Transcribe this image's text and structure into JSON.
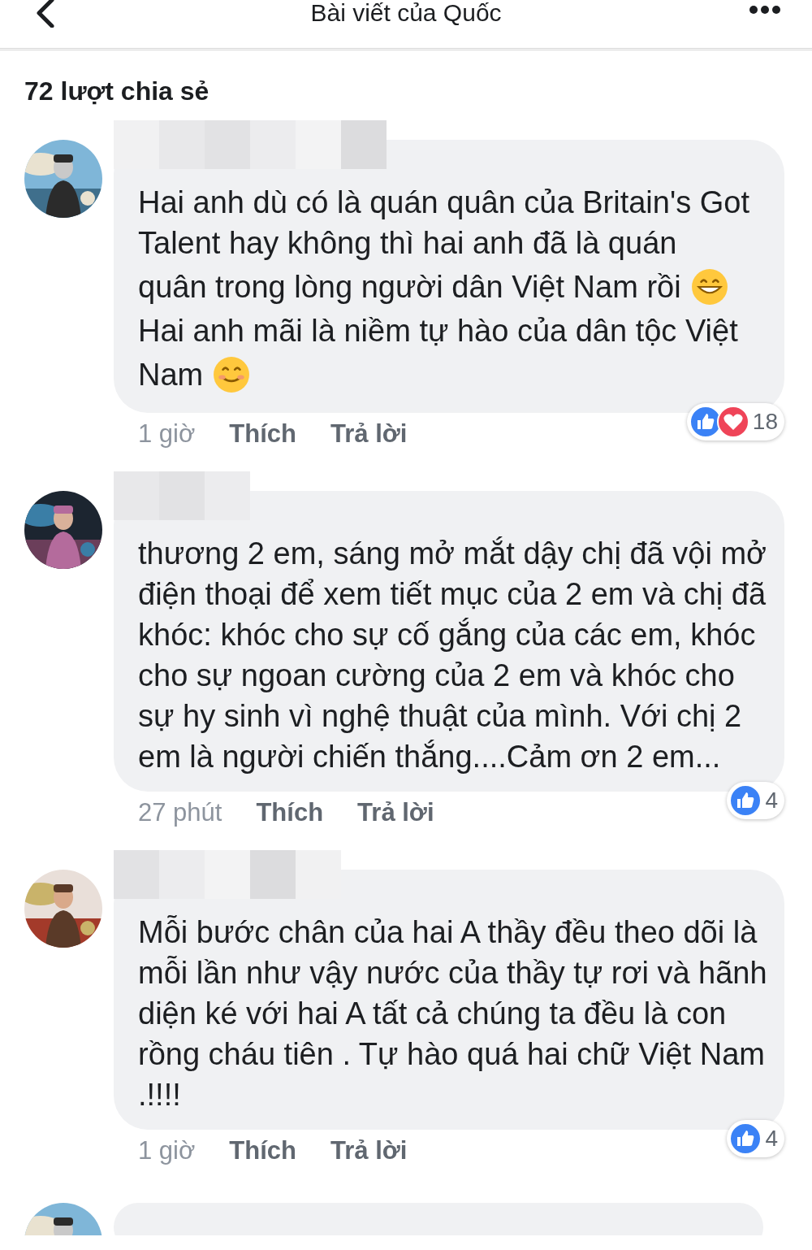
{
  "header": {
    "title": "Bài viết của Quốc"
  },
  "share_count": "72 lượt chia sẻ",
  "comments": [
    {
      "avatar": {
        "kind": "picture"
      },
      "segments": [
        {
          "text": "Hai anh dù có là quán quân của Britain's Got Talent hay không thì hai anh đã là quán"
        },
        {
          "text": "quân trong lòng người dân Việt Nam rồi",
          "emoji": {
            "kind": "grin"
          }
        },
        {
          "text": "Hai anh mãi là niềm tự hào của dân tộc Việt"
        },
        {
          "text": "Nam",
          "emoji": {
            "kind": "smile"
          }
        }
      ],
      "time": "1 giờ",
      "like": "Thích",
      "reply": "Trả lời",
      "reactions": [
        {
          "kind": "like"
        },
        {
          "kind": "love"
        }
      ],
      "reaction_count": "18"
    },
    {
      "avatar": {
        "kind": "picture"
      },
      "segments": [
        {
          "text": "thương 2 em, sáng mở mắt dậy chị đã vội mở điện thoại để xem tiết mục của 2 em và chị đã khóc: khóc cho sự cố gắng của các em, khóc cho sự ngoan cường của 2 em và khóc cho sự hy sinh vì nghệ thuật của mình. Với chị 2 em là người chiến thắng....Cảm ơn 2 em..."
        }
      ],
      "time": "27 phút",
      "like": "Thích",
      "reply": "Trả lời",
      "reactions": [
        {
          "kind": "like"
        }
      ],
      "reaction_count": "4"
    },
    {
      "avatar": {
        "kind": "picture"
      },
      "segments": [
        {
          "text": "Mỗi bước chân của hai A thầy đều theo dõi là mỗi lần như vậy nước của thầy tự rơi và hãnh diện ké với hai A  tất cả chúng ta đều là con rồng cháu tiên . Tự hào quá hai chữ Việt Nam .!!!!"
        }
      ],
      "time": "1 giờ",
      "like": "Thích",
      "reply": "Trả lời",
      "reactions": [
        {
          "kind": "like"
        }
      ],
      "reaction_count": "4"
    }
  ]
}
